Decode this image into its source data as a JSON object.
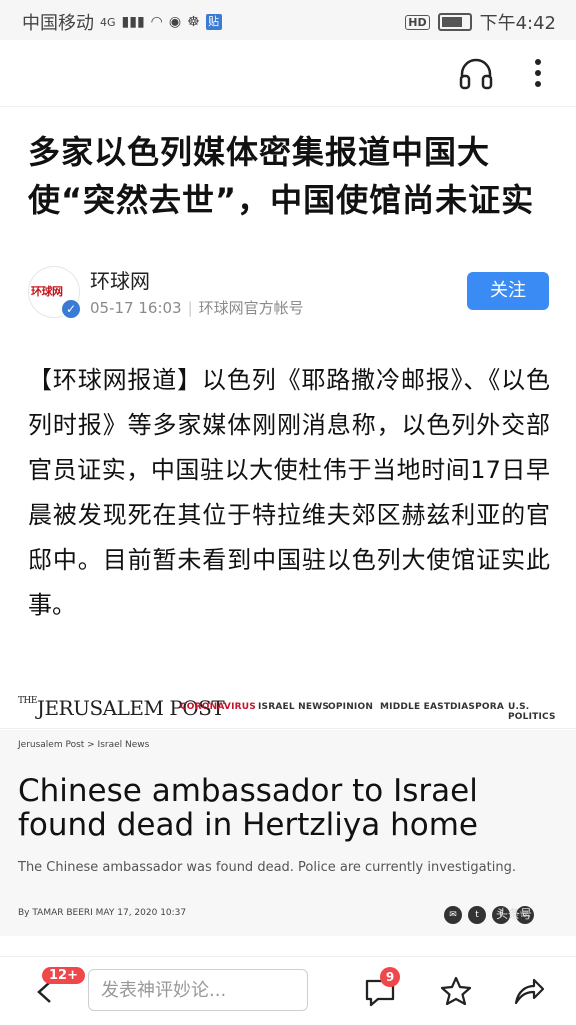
{
  "status_bar": {
    "carrier": "中国移动",
    "network": "4G",
    "hd": "HD",
    "time": "下午4:42"
  },
  "article": {
    "title": "多家以色列媒体密集报道中国大使“突然去世”，中国使馆尚未证实",
    "author": {
      "name": "环球网",
      "avatar_text": "环球网",
      "date": "05-17 16:03",
      "account": "环球网官方帐号",
      "follow_label": "关注"
    },
    "body": "【环球网报道】以色列《耶路撒冷邮报》、《以色列时报》等多家媒体刚刚消息称，以色列外交部官员证实，中国驻以大使杜伟于当地时间17日早晨被发现死在其位于特拉维夫郊区赫兹利亚的官邸中。目前暂未看到中国驻以色列大使馆证实此事。"
  },
  "embedded_screenshot": {
    "logo": "THE JERUSALEM POST",
    "logo_prefix": "THE",
    "logo_main": "JERUSALEM POST",
    "nav": [
      "CORONAVIRUS",
      "ISRAEL NEWS",
      "OPINION",
      "MIDDLE EAST",
      "DIASPORA",
      "U.S. POLITICS"
    ],
    "breadcrumb": "Jerusalem Post  >  Israel News",
    "headline": "Chinese ambassador to Israel found dead in Hertzliya home",
    "subheadline": "The Chinese ambassador was found dead. Police are currently investigating.",
    "byline": "By TAMAR BEERI   MAY 17, 2020 10:37",
    "watermark": "头条号"
  },
  "bottom_bar": {
    "back_badge": "12+",
    "comment_placeholder": "发表神评妙论...",
    "comment_count": "9"
  },
  "colors": {
    "accent_blue": "#3b8bf4",
    "badge_red": "#f0484a",
    "jp_red": "#c0152a"
  }
}
